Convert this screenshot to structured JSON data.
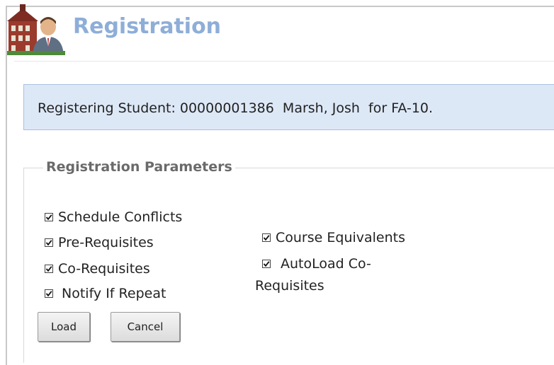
{
  "header": {
    "title": "Registration",
    "logo_icon": "campus-building-student-icon"
  },
  "info": {
    "text": "Registering Student: 00000001386  Marsh, Josh  for FA-10."
  },
  "params": {
    "legend": "Registration Parameters",
    "options": {
      "schedule_conflicts": {
        "label": "Schedule Conflicts",
        "checked": true
      },
      "pre_requisites": {
        "label": "Pre-Requisites",
        "checked": true
      },
      "co_requisites": {
        "label": "Co-Requisites",
        "checked": true
      },
      "notify_if_repeat": {
        "label": "Notify If Repeat",
        "checked": true
      },
      "course_equivalents": {
        "label": "Course Equivalents",
        "checked": true
      },
      "autoload_co_requisites": {
        "label_line1": "AutoLoad Co-",
        "label_line2": "Requisites",
        "checked": true
      }
    }
  },
  "buttons": {
    "load": "Load",
    "cancel": "Cancel"
  },
  "colors": {
    "title": "#8eaed8",
    "info_bg": "#dde8f7",
    "info_border": "#a8bfe0",
    "legend": "#6a6a6a"
  }
}
